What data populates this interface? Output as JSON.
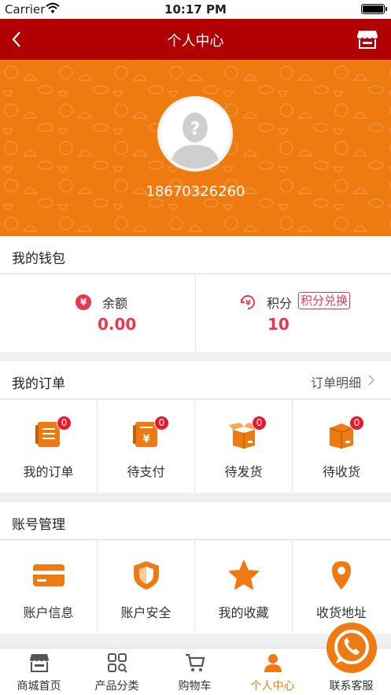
{
  "status": {
    "carrier": "Carrier",
    "time": "10:17 PM"
  },
  "nav": {
    "title": "个人中心",
    "back_icon": "chevron-left-icon",
    "store_icon": "store-icon"
  },
  "profile": {
    "phone": "18670326260",
    "avatar_icon": "default-avatar-icon"
  },
  "wallet": {
    "title": "我的钱包",
    "balance_label": "余额",
    "balance_value": "0.00",
    "points_label": "积分",
    "points_value": "10",
    "exchange_label": "积分兑换",
    "coin_symbol": "¥"
  },
  "orders": {
    "title": "我的订单",
    "detail_label": "订单明细",
    "items": [
      {
        "label": "我的订单",
        "badge": "0",
        "icon": "order-list-icon"
      },
      {
        "label": "待支付",
        "badge": "0",
        "icon": "pending-payment-icon"
      },
      {
        "label": "待发货",
        "badge": "0",
        "icon": "pending-shipment-icon"
      },
      {
        "label": "待收货",
        "badge": "0",
        "icon": "pending-receipt-icon"
      }
    ]
  },
  "account": {
    "title": "账号管理",
    "items": [
      {
        "label": "账户信息",
        "icon": "card-icon"
      },
      {
        "label": "账户安全",
        "icon": "shield-icon"
      },
      {
        "label": "我的收藏",
        "icon": "star-icon"
      },
      {
        "label": "收货地址",
        "icon": "location-pin-icon"
      }
    ]
  },
  "tabs": [
    {
      "label": "商城首页",
      "icon": "shop-icon"
    },
    {
      "label": "产品分类",
      "icon": "category-icon"
    },
    {
      "label": "购物车",
      "icon": "cart-icon"
    },
    {
      "label": "个人中心",
      "icon": "user-icon"
    },
    {
      "label": "联系客服",
      "icon": "phone-icon"
    }
  ],
  "colors": {
    "nav": "#b00004",
    "accent": "#ee7b10",
    "value_red": "#e8384f"
  }
}
